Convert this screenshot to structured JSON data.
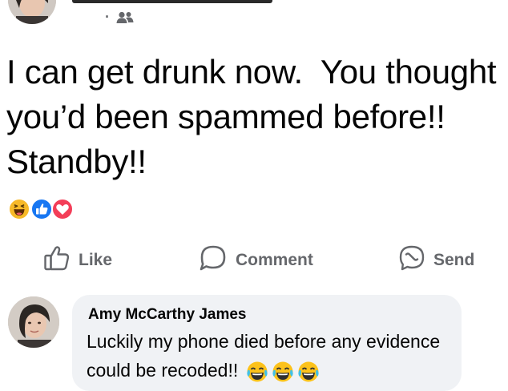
{
  "post": {
    "text": "I can get drunk now.  You thought you’d been spammed before!! Standby!!",
    "audience_separator": "·",
    "audience_icon": "friends-icon",
    "reaction_icons": [
      "haha-reaction-icon",
      "like-reaction-icon",
      "love-reaction-icon"
    ]
  },
  "actions": {
    "like_label": "Like",
    "comment_label": "Comment",
    "send_label": "Send"
  },
  "comment": {
    "author": "Amy McCarthy James",
    "text": "Luckily my phone died before any evidence could be recoded!!",
    "emoji": [
      "tears-of-joy-emoji",
      "tears-of-joy-emoji",
      "tears-of-joy-emoji"
    ]
  },
  "colors": {
    "action_gray": "#65676b",
    "like_blue": "#1877f2",
    "love_red": "#f33e58",
    "haha_yellow": "#f7b928",
    "comment_bg": "#f0f2f5"
  }
}
